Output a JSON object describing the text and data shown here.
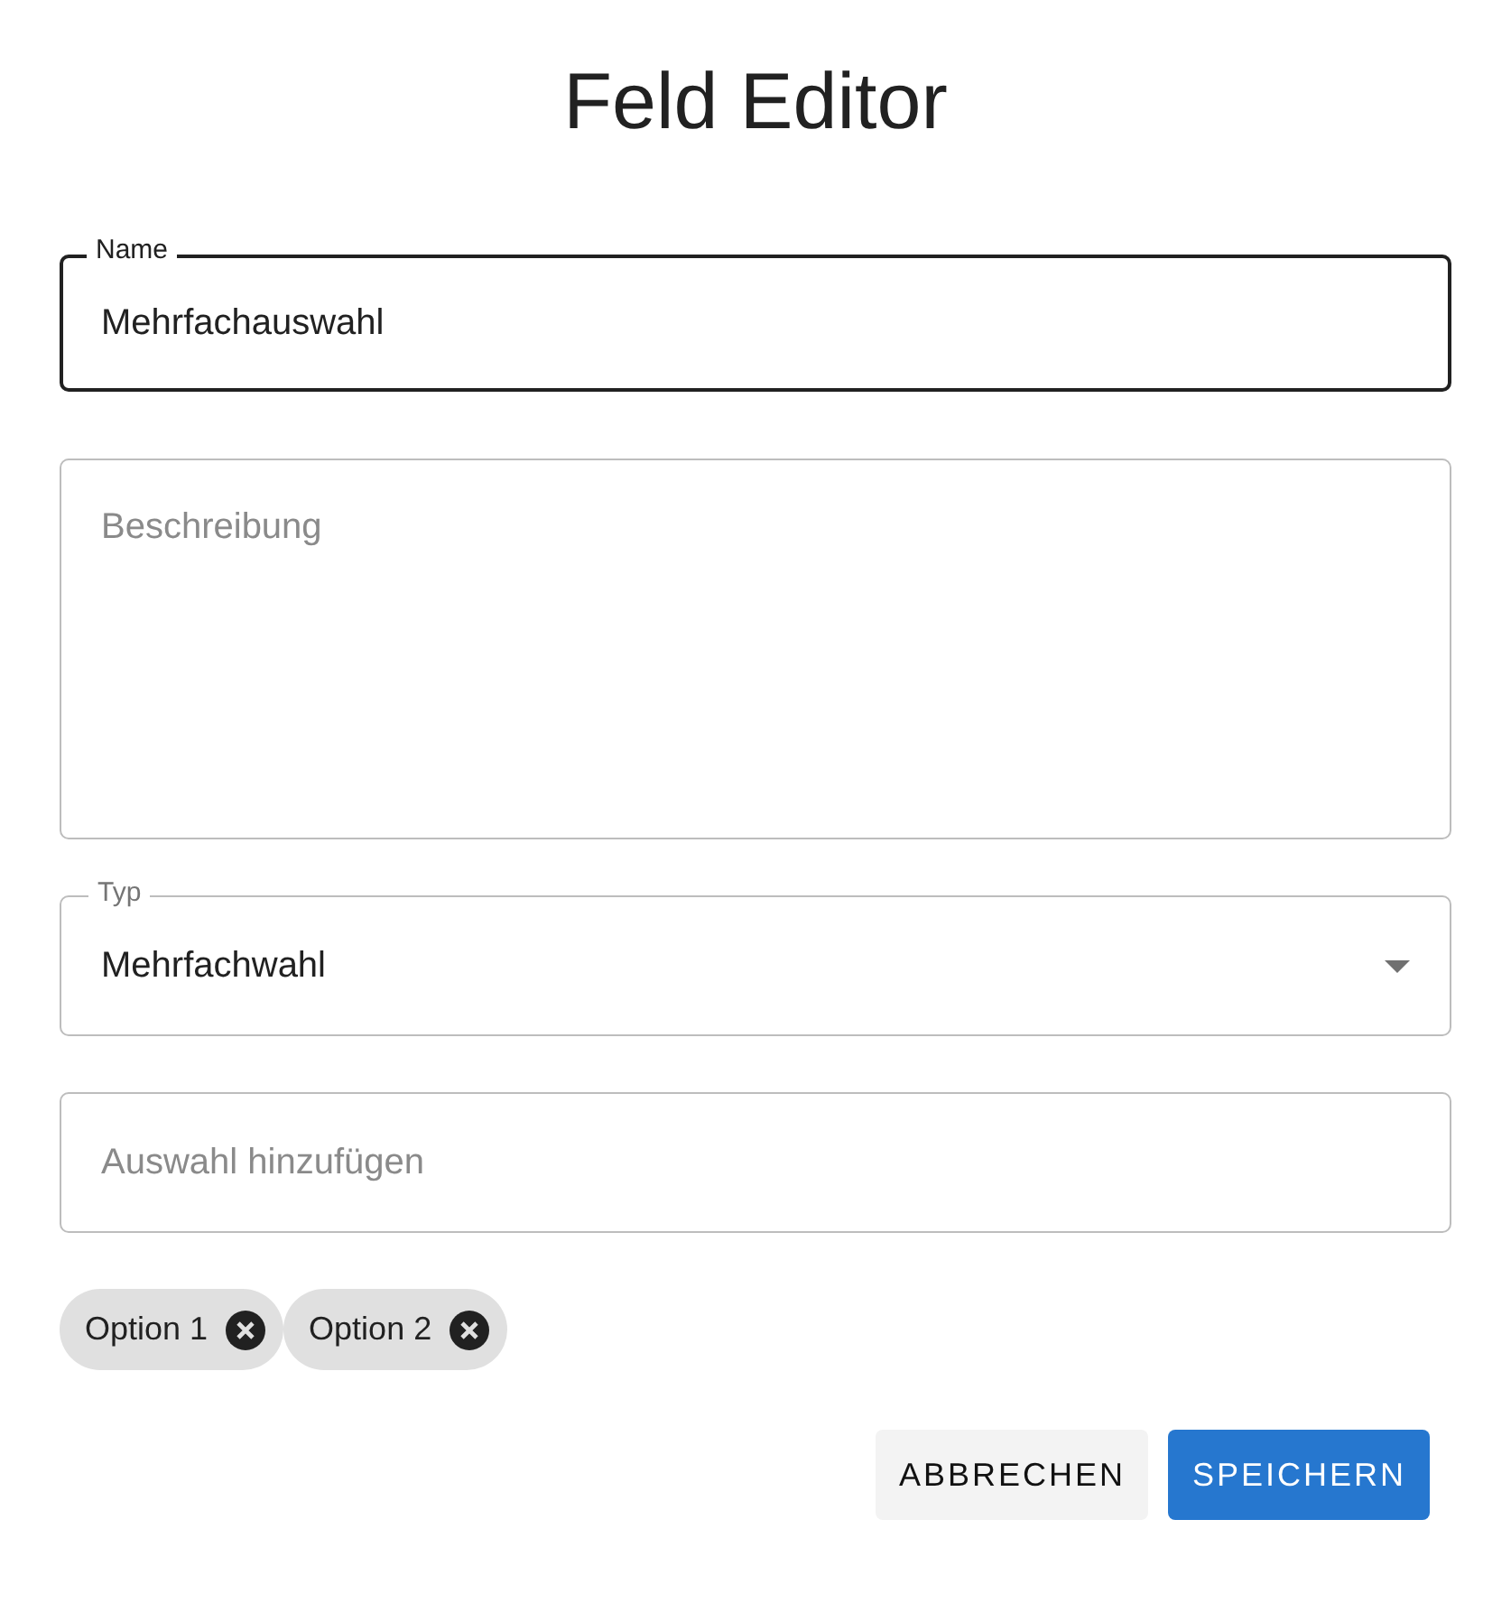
{
  "dialog": {
    "title": "Feld Editor"
  },
  "fields": [
    {
      "kind": "text",
      "label": "Name",
      "value": "Mehrfachauswahl",
      "focused": true
    },
    {
      "kind": "textarea",
      "placeholder": "Beschreibung",
      "focused": false
    },
    {
      "kind": "select",
      "label": "Typ",
      "value": "Mehrfachwahl",
      "focused": false
    },
    {
      "kind": "text",
      "placeholder": "Auswahl hinzufügen",
      "focused": false
    }
  ],
  "chips": [
    {
      "label": "Option 1"
    },
    {
      "label": "Option 2"
    }
  ],
  "buttons": [
    {
      "label": "ABBRECHEN",
      "kind": "secondary"
    },
    {
      "label": "SPEICHERN",
      "kind": "primary"
    }
  ]
}
